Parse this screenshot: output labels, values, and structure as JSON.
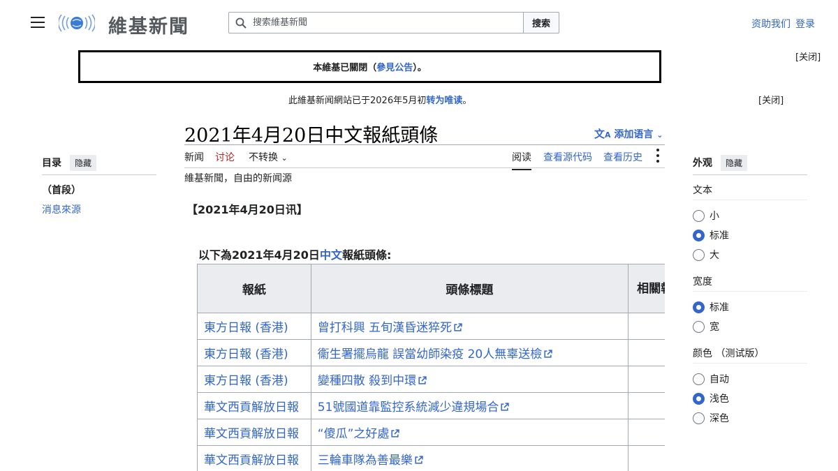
{
  "header": {
    "logo_text": "維基新聞",
    "search_placeholder": "搜索維基新聞",
    "search_button": "搜索",
    "donate": "资助我们",
    "login": "登录"
  },
  "banners": {
    "notice_prefix": "本維基已關閉（",
    "notice_link": "參見公告",
    "notice_suffix": "）。",
    "close_1": "[关闭]",
    "notice2_prefix": "此維基新闻網站已于2026年5月初",
    "notice2_link": "转为唯读",
    "notice2_suffix": "。",
    "close_2": "[关闭]"
  },
  "article": {
    "title": "2021年4月20日中文報紙頭條",
    "add_languages": "添加语言",
    "tabs_left": [
      "新闻",
      "讨论",
      "不转换"
    ],
    "tabs_right": [
      "阅读",
      "查看源代码",
      "查看历史"
    ],
    "tagline": "維基新聞，自由的新闻源",
    "dateline": "【2021年4月20日讯】",
    "intro_prefix": "以下為2021年4月20日",
    "intro_link": "中文",
    "intro_suffix": "報紙頭條:"
  },
  "table": {
    "headers": [
      "報紙",
      "頭條標題",
      "相關報導"
    ],
    "rows": [
      {
        "paper": "東方日報 (香港)",
        "headline": "曾打科興 五旬漢昏迷猝死"
      },
      {
        "paper": "東方日報 (香港)",
        "headline": "衞生署擺烏龍 誤當幼師染疫 20人無辜送檢"
      },
      {
        "paper": "東方日報 (香港)",
        "headline": "變種四散 殺到中環"
      },
      {
        "paper": "華文西貢解放日報",
        "headline": "51號國道靠監控系統減少違規場合"
      },
      {
        "paper": "華文西貢解放日報",
        "headline": "“傻瓜”之好處"
      },
      {
        "paper": "華文西貢解放日報",
        "headline": "三輪車隊為善最樂"
      }
    ]
  },
  "toc": {
    "title": "目录",
    "hide": "隐藏",
    "items": [
      "（首段）",
      "消息來源"
    ]
  },
  "appearance": {
    "title": "外观",
    "hide": "隐藏",
    "text_label": "文本",
    "text_options": [
      "小",
      "标准",
      "大"
    ],
    "text_selected": 1,
    "width_label": "宽度",
    "width_options": [
      "标准",
      "宽"
    ],
    "width_selected": 0,
    "color_label": "颜色 （测试版）",
    "color_options": [
      "自动",
      "浅色",
      "深色"
    ],
    "color_selected": 1
  },
  "colors": {
    "link": "#3366cc",
    "talk_link": "#b32424",
    "radio_selected": "#3366cc"
  }
}
